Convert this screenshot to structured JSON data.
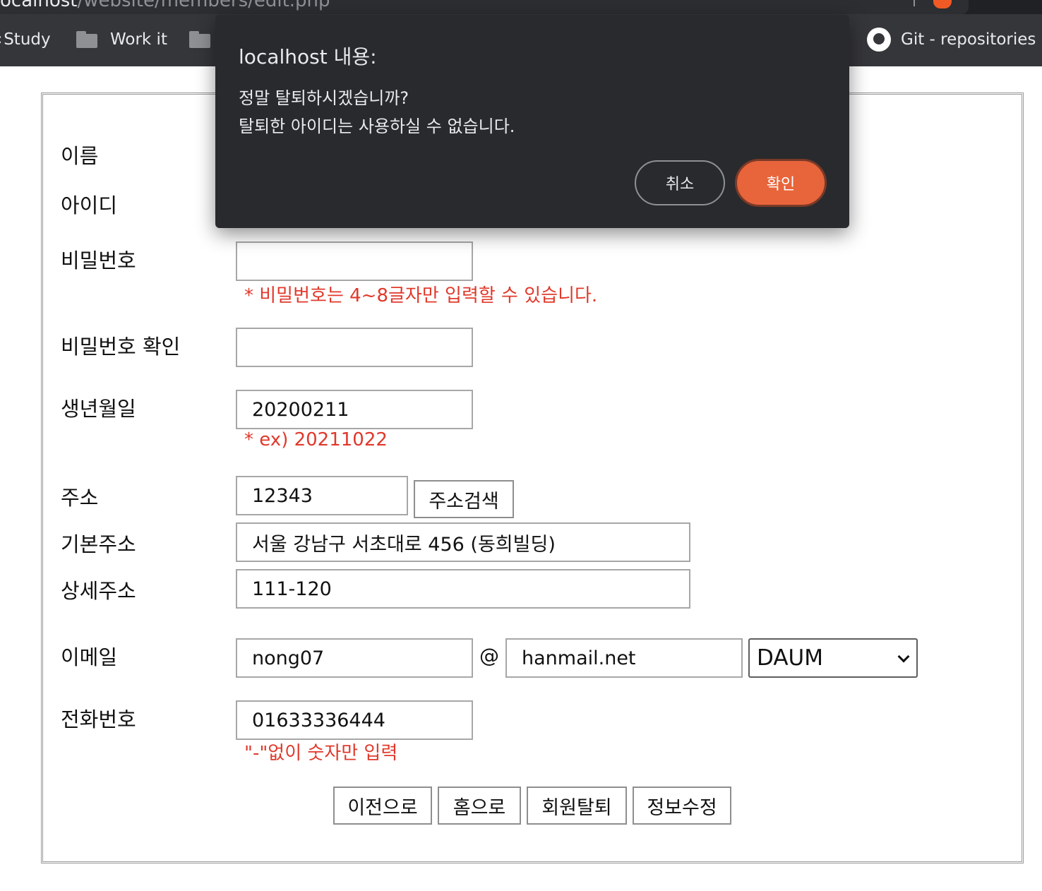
{
  "browser": {
    "url_host": "ocalhost",
    "url_path": "/website/members/edit.php",
    "bookmarks": [
      "Study",
      "Work it",
      "Git - repositories"
    ]
  },
  "dialog": {
    "title": "localhost 내용:",
    "message_line1": "정말 탈퇴하시겠습니까?",
    "message_line2": "탈퇴한 아이디는 사용하실 수 없습니다.",
    "cancel_label": "취소",
    "ok_label": "확인",
    "ok_color": "#e8643b"
  },
  "form": {
    "labels": {
      "name": "이름",
      "id": "아이디",
      "password": "비밀번호",
      "password_confirm": "비밀번호 확인",
      "birth": "생년월일",
      "zipcode": "주소",
      "address_basic": "기본주소",
      "address_detail": "상세주소",
      "email": "이메일",
      "phone": "전화번호"
    },
    "values": {
      "password": "",
      "password_confirm": "",
      "birth": "20200211",
      "zipcode": "12343",
      "address_basic": "서울 강남구 서초대로 456 (동희빌딩)",
      "address_detail": "111-120",
      "email_id": "nong07",
      "email_at": "@",
      "email_domain": "hanmail.net",
      "email_select": "DAUM",
      "phone": "01633336444"
    },
    "hints": {
      "password": "* 비밀번호는 4~8글자만 입력할 수 있습니다.",
      "birth": "* ex) 20211022",
      "phone": "\"-\"없이 숫자만 입력"
    },
    "hint_color": "#e0392b",
    "address_search_label": "주소검색",
    "buttons": {
      "back": "이전으로",
      "home": "홈으로",
      "withdraw": "회원탈퇴",
      "update": "정보수정"
    }
  }
}
